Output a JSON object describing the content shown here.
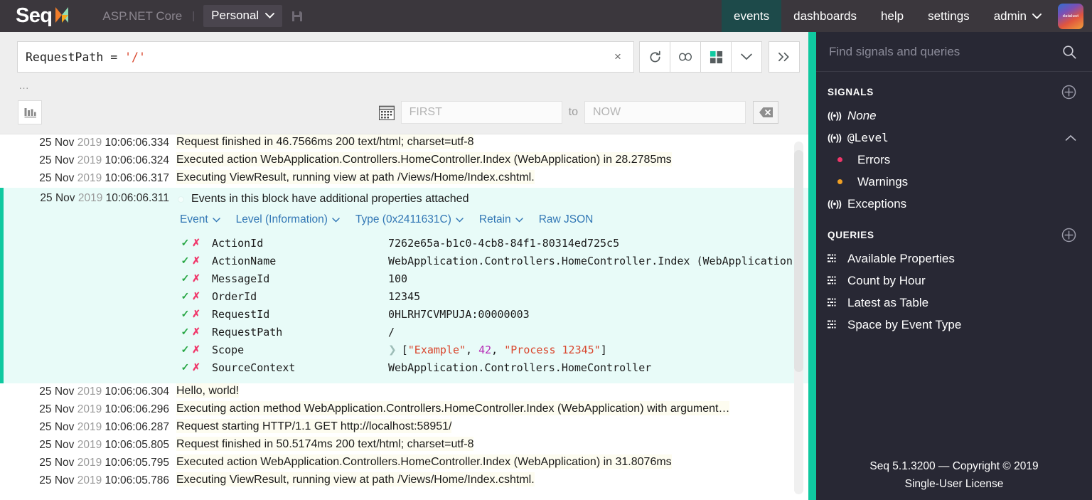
{
  "header": {
    "logo_text": "Seq",
    "app_context": "ASP.NET Core",
    "separator": "|",
    "workspace": "Personal",
    "save_icon": "save-icon",
    "nav": [
      {
        "label": "events",
        "active": true
      },
      {
        "label": "dashboards",
        "active": false
      },
      {
        "label": "help",
        "active": false
      },
      {
        "label": "settings",
        "active": false
      },
      {
        "label": "admin",
        "active": false,
        "has_caret": true
      }
    ],
    "avatar_label": "datalust"
  },
  "query": {
    "expression_name": "RequestPath = ",
    "expression_value": "'/'",
    "clear_label": "×",
    "buttons": [
      {
        "name": "refresh-button",
        "glyph": "refresh"
      },
      {
        "name": "link-button",
        "glyph": "infinity"
      },
      {
        "name": "layout-button",
        "glyph": "grid"
      },
      {
        "name": "more-options-button",
        "glyph": "chevron-down"
      },
      {
        "name": "expand-button",
        "glyph": "double-chevron-right"
      }
    ],
    "ellipsis": "…"
  },
  "filters": {
    "chart_button": "bar-chart-icon",
    "calendar_icon": "calendar-icon",
    "from_placeholder": "FIRST",
    "from_value": "",
    "to_label": "to",
    "to_placeholder": "NOW",
    "to_value": "",
    "clear_range_icon": "backspace-icon"
  },
  "events": {
    "rows_above": [
      {
        "date": "25 Nov ",
        "year": "2019",
        "time": " 10:06:06.334",
        "message": "Request finished in 46.7566ms 200 text/html; charset=utf-8"
      },
      {
        "date": "25 Nov ",
        "year": "2019",
        "time": " 10:06:06.324",
        "message": "Executed action WebApplication.Controllers.HomeController.Index (WebApplication) in 28.2785ms"
      },
      {
        "date": "25 Nov ",
        "year": "2019",
        "time": " 10:06:06.317",
        "message": "Executing ViewResult, running view at path /Views/Home/Index.cshtml."
      }
    ],
    "selected": {
      "date": "25 Nov ",
      "year": "2019",
      "time": " 10:06:06.311",
      "message": "Events in this block have additional properties attached",
      "menu": [
        {
          "label": "Event",
          "caret": true
        },
        {
          "label": "Level (Information)",
          "caret": true
        },
        {
          "label": "Type (0x2411631C)",
          "caret": true
        },
        {
          "label": "Retain",
          "caret": true
        },
        {
          "label": "Raw JSON",
          "caret": false
        }
      ],
      "properties": [
        {
          "name": "ActionId",
          "value": "7262e65a-b1c0-4cb8-84f1-80314ed725c5",
          "expandable": false
        },
        {
          "name": "ActionName",
          "value": "WebApplication.Controllers.HomeController.Index (WebApplication)",
          "expandable": false
        },
        {
          "name": "MessageId",
          "value": "100",
          "expandable": false
        },
        {
          "name": "OrderId",
          "value": "12345",
          "expandable": false
        },
        {
          "name": "RequestId",
          "value": "0HLRH7CVMPUJA:00000003",
          "expandable": false
        },
        {
          "name": "RequestPath",
          "value": "/",
          "expandable": false
        },
        {
          "name": "Scope",
          "value": "[\"Example\", 42, \"Process 12345\"]",
          "expandable": true,
          "tokens": [
            {
              "t": "[",
              "k": "p"
            },
            {
              "t": "\"Example\"",
              "k": "s"
            },
            {
              "t": ", ",
              "k": "p"
            },
            {
              "t": "42",
              "k": "n"
            },
            {
              "t": ", ",
              "k": "p"
            },
            {
              "t": "\"Process 12345\"",
              "k": "s"
            },
            {
              "t": "]",
              "k": "p"
            }
          ]
        },
        {
          "name": "SourceContext",
          "value": "WebApplication.Controllers.HomeController",
          "expandable": false
        }
      ],
      "include_label": "✓",
      "exclude_label": "✗"
    },
    "rows_below": [
      {
        "date": "25 Nov ",
        "year": "2019",
        "time": " 10:06:06.304",
        "message": "Hello, world!"
      },
      {
        "date": "25 Nov ",
        "year": "2019",
        "time": " 10:06:06.296",
        "message": "Executing action method WebApplication.Controllers.HomeController.Index (WebApplication) with argument…"
      },
      {
        "date": "25 Nov ",
        "year": "2019",
        "time": " 10:06:06.287",
        "message": "Request starting HTTP/1.1 GET http://localhost:58951/"
      },
      {
        "date": "25 Nov ",
        "year": "2019",
        "time": " 10:06:05.805",
        "message": "Request finished in 50.5174ms 200 text/html; charset=utf-8"
      },
      {
        "date": "25 Nov ",
        "year": "2019",
        "time": " 10:06:05.795",
        "message": "Executed action WebApplication.Controllers.HomeController.Index (WebApplication) in 31.8076ms"
      },
      {
        "date": "25 Nov ",
        "year": "2019",
        "time": " 10:06:05.786",
        "message": "Executing ViewResult, running view at path /Views/Home/Index.cshtml."
      }
    ]
  },
  "sidebar": {
    "search_placeholder": "Find signals and queries",
    "search_value": "",
    "signals_title": "SIGNALS",
    "signals": [
      {
        "label": "None",
        "icon": "signal-icon",
        "style": "italic"
      },
      {
        "label": "@Level",
        "icon": "signal-icon",
        "style": "mono",
        "expanded": true
      }
    ],
    "level_children": [
      {
        "label": "Errors",
        "icon": "dot-icon",
        "color": "#f0376a"
      },
      {
        "label": "Warnings",
        "icon": "dot-icon",
        "color": "#f0a024"
      }
    ],
    "signals_tail": [
      {
        "label": "Exceptions",
        "icon": "signal-icon",
        "style": "normal"
      }
    ],
    "queries_title": "QUERIES",
    "queries": [
      {
        "label": "Available Properties",
        "icon": "table-icon"
      },
      {
        "label": "Count by Hour",
        "icon": "table-icon"
      },
      {
        "label": "Latest as Table",
        "icon": "table-icon"
      },
      {
        "label": "Space by Event Type",
        "icon": "table-icon"
      }
    ],
    "footer_line1": "Seq 5.1.3200 — Copyright © 2019",
    "footer_line2": "Single-User License"
  },
  "colors": {
    "accent_teal": "#0fc9a0",
    "nav_bg": "#3b373d",
    "nav_active": "#1d4a4a",
    "sidebar_bg": "#282834",
    "selected_row": "#e8fbf8",
    "link_blue": "#3277b5",
    "string_red": "#d9472e",
    "number_purple": "#b52ab5",
    "error_pink": "#f0376a",
    "warning_orange": "#f0a024"
  }
}
